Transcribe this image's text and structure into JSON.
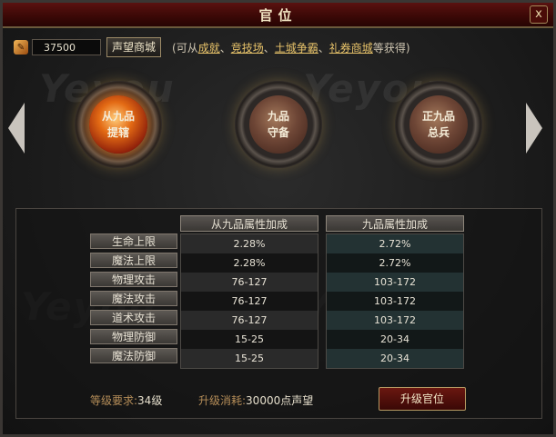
{
  "window": {
    "title": "官位",
    "close": "x"
  },
  "top": {
    "balance": "37500",
    "shop_button": "声望商城",
    "hint_prefix": "(可从",
    "hint_links": [
      "成就",
      "竞技场",
      "土城争霸",
      "礼券商城"
    ],
    "hint_sep": "、",
    "hint_suffix": "等获得)"
  },
  "ranks": [
    {
      "line1": "从九品",
      "line2": "提辖",
      "active": true
    },
    {
      "line1": "九品",
      "line2": "守备",
      "active": false
    },
    {
      "line1": "正九品",
      "line2": "总兵",
      "active": false
    }
  ],
  "table": {
    "col_current": "从九品属性加成",
    "col_next": "九品属性加成",
    "rows": [
      {
        "label": "生命上限",
        "current": "2.28%",
        "next": "2.72%"
      },
      {
        "label": "魔法上限",
        "current": "2.28%",
        "next": "2.72%"
      },
      {
        "label": "物理攻击",
        "current": "76-127",
        "next": "103-172"
      },
      {
        "label": "魔法攻击",
        "current": "76-127",
        "next": "103-172"
      },
      {
        "label": "道术攻击",
        "current": "76-127",
        "next": "103-172"
      },
      {
        "label": "物理防御",
        "current": "15-25",
        "next": "20-34"
      },
      {
        "label": "魔法防御",
        "current": "15-25",
        "next": "20-34"
      }
    ]
  },
  "footer": {
    "level_label": "等级要求:",
    "level_value": "34级",
    "cost_label": "升级消耗:",
    "cost_value": "30000点声望",
    "upgrade_button": "升级官位"
  },
  "watermark": "Yeyou"
}
